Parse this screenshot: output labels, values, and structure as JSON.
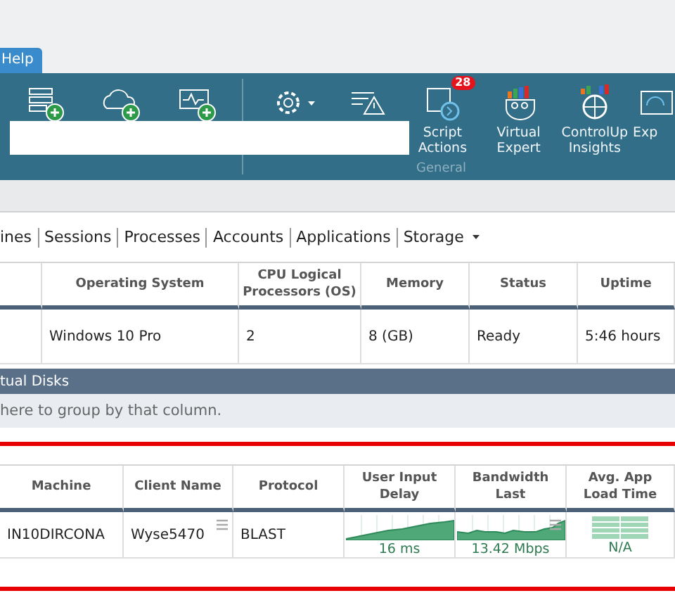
{
  "menu_tabs": [
    {
      "label": "Help",
      "selected": true
    }
  ],
  "ribbon": {
    "buttons": [
      {
        "kind": "icon"
      },
      {
        "kind": "icon"
      },
      {
        "kind": "icon"
      },
      {
        "kind": "icon",
        "dropdown": true
      },
      {
        "kind": "icon"
      },
      {
        "kind": "labeled",
        "label": "Script Actions",
        "badge": "28"
      },
      {
        "kind": "labeled",
        "label": "Virtual Expert"
      },
      {
        "kind": "labeled",
        "label": "ControlUp Insights"
      },
      {
        "kind": "labeled",
        "label": "Exp"
      }
    ],
    "group_label": "General"
  },
  "view_tabs": [
    {
      "label": "ines"
    },
    {
      "label": "Sessions"
    },
    {
      "label": "Processes"
    },
    {
      "label": "Accounts"
    },
    {
      "label": "Applications"
    },
    {
      "label": "Storage",
      "dropdown": true
    }
  ],
  "machines_table": {
    "columns": [
      "Operating System",
      "CPU Logical Processors (OS)",
      "Memory",
      "Status",
      "Uptime"
    ],
    "rows": [
      {
        "cells": [
          {
            "kind": "text",
            "text": "Windows 10 Pro"
          },
          {
            "kind": "text",
            "text": "2"
          },
          {
            "kind": "text",
            "text": "8 (GB)"
          },
          {
            "kind": "text",
            "text": "Ready"
          },
          {
            "kind": "text",
            "text": "5:46 hours"
          }
        ]
      }
    ]
  },
  "section_bar": {
    "title": "tual Disks"
  },
  "group_hint": "here to group by that column.",
  "sessions_table": {
    "columns": [
      "Machine",
      "Client Name",
      "Protocol",
      "User Input Delay",
      "Bandwidth Last",
      "Avg. App Load Time"
    ],
    "rows": [
      {
        "cells": [
          {
            "kind": "text",
            "text": "IN10DIRCONA"
          },
          {
            "kind": "text",
            "text": "Wyse5470",
            "menu": true
          },
          {
            "kind": "text",
            "text": "BLAST"
          },
          {
            "kind": "sparkline",
            "reading": "16 ms"
          },
          {
            "kind": "sparkline",
            "reading": "13.42 Mbps",
            "menu": true
          },
          {
            "kind": "empty-chart",
            "reading": "N/A"
          }
        ]
      }
    ]
  }
}
